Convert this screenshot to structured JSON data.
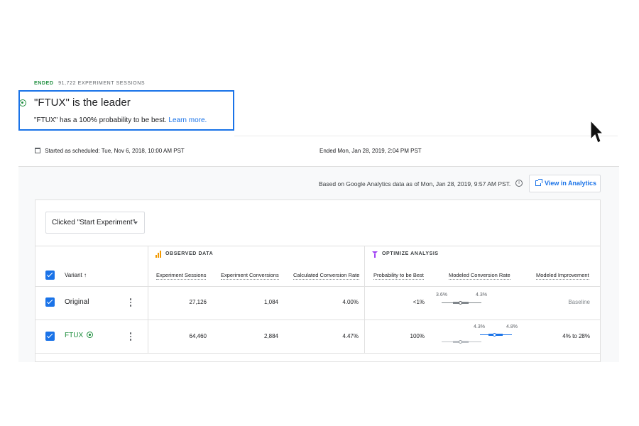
{
  "status": {
    "state": "ENDED",
    "sessions_text": "91,722 EXPERIMENT SESSIONS"
  },
  "leader": {
    "title": "\"FTUX\" is the leader",
    "subtitle": "\"FTUX\" has a 100% probability to be best.",
    "learn_more": "Learn more."
  },
  "schedule": {
    "started_label": "Started as scheduled:",
    "started_value": "Tue, Nov 6, 2018, 10:00 AM PST",
    "ended_label": "Ended",
    "ended_value": "Mon, Jan 28, 2019, 2:04 PM PST"
  },
  "analytics": {
    "based_on": "Based on Google Analytics data as of Mon, Jan 28, 2019, 9:57 AM PST.",
    "view_button": "View in Analytics"
  },
  "objective": {
    "selected": "Clicked \"Start Experiment\""
  },
  "sections": {
    "observed": "OBSERVED DATA",
    "optimize": "OPTIMIZE ANALYSIS"
  },
  "columns": {
    "variant": "Variant",
    "sessions": "Experiment Sessions",
    "conversions": "Experiment Conversions",
    "calc_rate": "Calculated Conversion Rate",
    "prob_best": "Probability to be Best",
    "modeled_rate": "Modeled Conversion Rate",
    "modeled_improvement": "Modeled Improvement"
  },
  "rows": [
    {
      "name": "Original",
      "sessions": "27,126",
      "conversions": "1,084",
      "rate": "4.00%",
      "prob": "<1%",
      "ci_low": "3.6%",
      "ci_high": "4.3%",
      "improvement": "Baseline"
    },
    {
      "name": "FTUX",
      "sessions": "64,460",
      "conversions": "2,884",
      "rate": "4.47%",
      "prob": "100%",
      "ci_low": "4.3%",
      "ci_high": "4.8%",
      "improvement": "4% to 28%"
    }
  ],
  "colors": {
    "accent": "#1a73e8",
    "winner": "#1e8e3e",
    "observed": "#f29900",
    "optimize": "#a142f4"
  }
}
